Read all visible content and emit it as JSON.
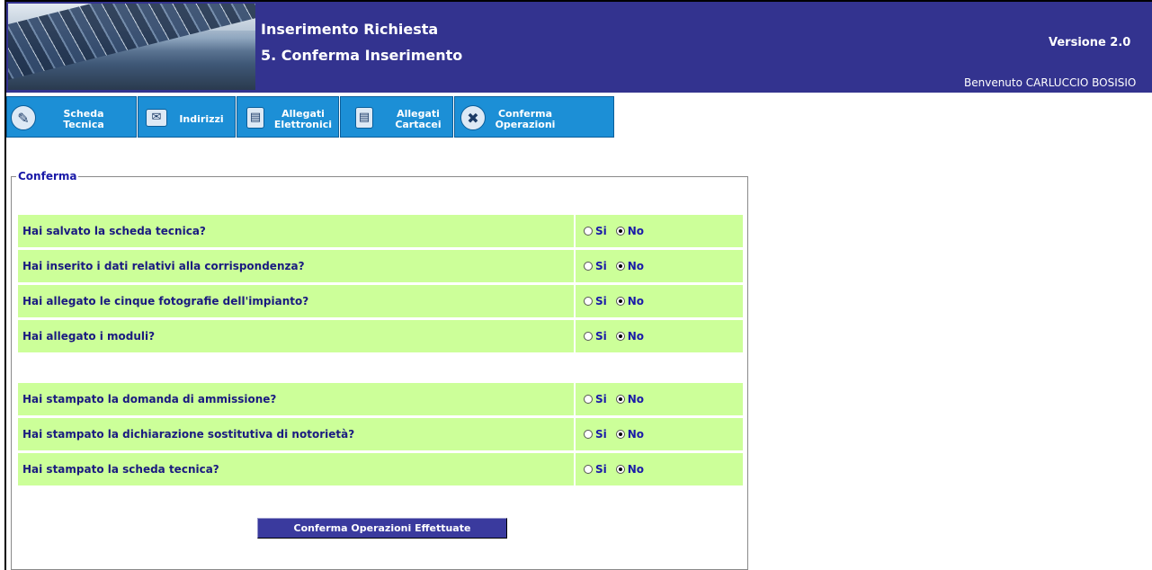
{
  "header": {
    "title_line1": "Inserimento Richiesta",
    "title_line2": "5. Conferma Inserimento",
    "version": "Versione 2.0",
    "welcome": "Benvenuto CARLUCCIO BOSISIO"
  },
  "tabs": [
    {
      "line1": "Scheda",
      "line2": "Tecnica",
      "icon": "pencil-icon"
    },
    {
      "line1": "Indirizzi",
      "line2": "",
      "icon": "envelope-icon"
    },
    {
      "line1": "Allegati",
      "line2": "Elettronici",
      "icon": "document-icon"
    },
    {
      "line1": "Allegati",
      "line2": "Cartacei",
      "icon": "document-icon"
    },
    {
      "line1": "Conferma",
      "line2": "Operazioni",
      "icon": "tools-icon"
    }
  ],
  "form": {
    "legend": "Conferma",
    "option_yes": "Si",
    "option_no": "No",
    "questions": [
      {
        "text": "Hai salvato la scheda tecnica?",
        "selected": "No"
      },
      {
        "text": "Hai inserito i dati relativi alla corrispondenza?",
        "selected": "No"
      },
      {
        "text": "Hai allegato le cinque fotografie dell'impianto?",
        "selected": "No"
      },
      {
        "text": "Hai allegato i moduli?",
        "selected": "No"
      },
      {
        "text": "Hai stampato la domanda di ammissione?",
        "selected": "No"
      },
      {
        "text": "Hai stampato la dichiarazione sostitutiva di notorietà?",
        "selected": "No"
      },
      {
        "text": "Hai stampato la scheda tecnica?",
        "selected": "No"
      }
    ],
    "submit_label": "Conferma Operazioni Effettuate"
  },
  "colors": {
    "header_bg": "#33338f",
    "tab_bg": "#1c8fd6",
    "row_bg": "#ccff99",
    "text_blue": "#1a1aa8",
    "button_bg": "#3a3a9e"
  }
}
